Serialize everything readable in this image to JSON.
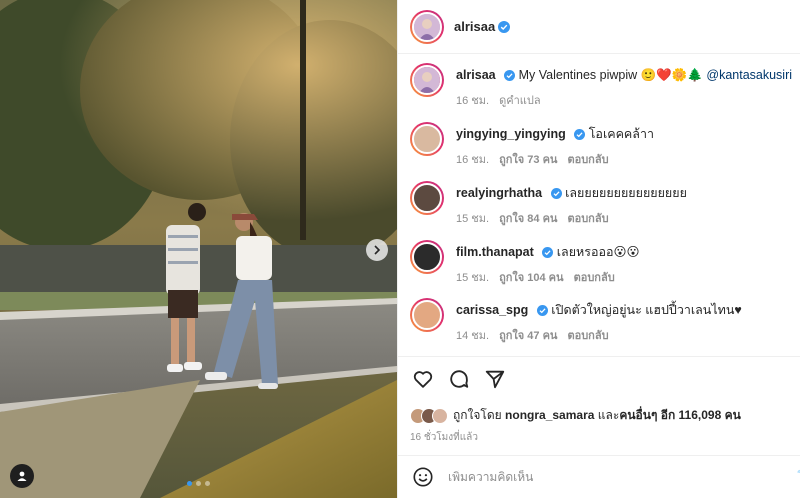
{
  "post": {
    "author": "alrisaa",
    "caption": {
      "username": "alrisaa",
      "text": "My Valentines piwpiw 🙂❤️🌼🌲",
      "mention": "@kantasakusiri",
      "time": "16 ชม.",
      "translate": "ดูคำแปล"
    }
  },
  "comments": [
    {
      "username": "yingying_yingying",
      "text": "โอเคคคล้าา",
      "time": "16 ชม.",
      "likes": "ถูกใจ 73 คน",
      "reply": "ตอบกลับ",
      "avatar_color": "#d9b9a0"
    },
    {
      "username": "realyingrhatha",
      "text": "เลยยยยยยยยยยยยยยย",
      "time": "15 ชม.",
      "likes": "ถูกใจ 84 คน",
      "reply": "ตอบกลับ",
      "avatar_color": "#5c4a40"
    },
    {
      "username": "film.thanapat",
      "text": "เลยหรอออ😮😮",
      "time": "15 ชม.",
      "likes": "ถูกใจ 104 คน",
      "reply": "ตอบกลับ",
      "avatar_color": "#2b2b2b"
    },
    {
      "username": "carissa_spg",
      "text": "เปิดตัวใหญ่อยู่นะ แฮปปี้วาเลนไทน♥",
      "time": "14 ชม.",
      "likes": "ถูกใจ 47 คน",
      "reply": "ตอบกลับ",
      "avatar_color": "#e3a882"
    }
  ],
  "likes": {
    "prefix": "ถูกใจโดย",
    "user": "nongra_samara",
    "middle": "และ",
    "others": "คนอื่นๆ อีก 116,098 คน"
  },
  "time_ago": "16 ชั่วโมงที่แล้ว",
  "add_comment": {
    "placeholder": "เพิ่มความคิดเห็น",
    "post_label": "โ"
  },
  "icons": {
    "like": "heart-icon",
    "comment": "comment-icon",
    "share": "share-icon",
    "emoji": "emoji-icon",
    "next": "chevron-right-icon",
    "tag": "user-tag-icon"
  },
  "colors": {
    "verified": "#3897f0",
    "ring": "#e1306c",
    "secondary": "#8e8e8e",
    "mention": "#00376b"
  },
  "carousel": {
    "total": 3,
    "active": 0
  }
}
